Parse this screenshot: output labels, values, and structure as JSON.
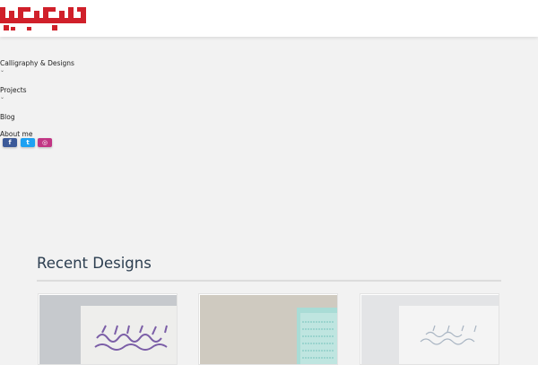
{
  "site": {
    "logo_alt": "نقاره زن"
  },
  "nav": {
    "items": [
      {
        "label": "Calligraphy & Designs",
        "has_dropdown": true
      },
      {
        "label": "Projects",
        "has_dropdown": true
      },
      {
        "label": "Blog",
        "has_dropdown": false
      },
      {
        "label": "About me",
        "has_dropdown": false
      }
    ],
    "chevron": "⌄"
  },
  "socials": [
    {
      "name": "facebook",
      "glyph": "f",
      "color": "#3b5998"
    },
    {
      "name": "twitter",
      "glyph": "t",
      "color": "#1da1f2"
    },
    {
      "name": "instagram",
      "glyph": "◎",
      "color": "#c13584"
    }
  ],
  "recent": {
    "title": "Recent Designs",
    "cards": [
      {
        "name": "design-card-1",
        "ink": "#7b5ea7"
      },
      {
        "name": "design-card-2",
        "ink": "#9ed8d2"
      },
      {
        "name": "design-card-3",
        "ink": "#a8b4c2"
      }
    ]
  },
  "colors": {
    "brand_red": "#d0202a",
    "title": "#2c3e50",
    "background": "#f2f2f2"
  }
}
